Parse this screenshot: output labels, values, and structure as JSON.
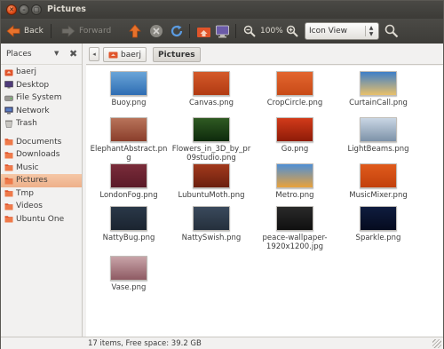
{
  "window": {
    "title": "Pictures"
  },
  "toolbar": {
    "back_label": "Back",
    "forward_label": "Forward",
    "zoom_level": "100%",
    "view_mode": "Icon View"
  },
  "sidebar": {
    "header": "Places",
    "items": [
      {
        "label": "baerj",
        "icon": "home-folder-icon",
        "group": 1
      },
      {
        "label": "Desktop",
        "icon": "desktop-icon",
        "group": 1
      },
      {
        "label": "File System",
        "icon": "drive-icon",
        "group": 1
      },
      {
        "label": "Network",
        "icon": "network-icon",
        "group": 1
      },
      {
        "label": "Trash",
        "icon": "trash-icon",
        "group": 1
      },
      {
        "label": "Documents",
        "icon": "folder-icon",
        "group": 2
      },
      {
        "label": "Downloads",
        "icon": "folder-icon",
        "group": 2
      },
      {
        "label": "Music",
        "icon": "folder-icon",
        "group": 2
      },
      {
        "label": "Pictures",
        "icon": "folder-icon",
        "group": 2,
        "active": true
      },
      {
        "label": "Tmp",
        "icon": "folder-icon",
        "group": 2
      },
      {
        "label": "Videos",
        "icon": "folder-icon",
        "group": 2
      },
      {
        "label": "Ubuntu One",
        "icon": "folder-icon",
        "group": 2
      }
    ]
  },
  "pathbar": {
    "crumbs": [
      "baerj",
      "Pictures"
    ]
  },
  "files": [
    {
      "name": "Buoy.png",
      "colors": [
        "#6aa5d8",
        "#2e6db3"
      ]
    },
    {
      "name": "Canvas.png",
      "colors": [
        "#d45a2a",
        "#b13a12"
      ]
    },
    {
      "name": "CropCircle.png",
      "colors": [
        "#e3662f",
        "#c84a17"
      ]
    },
    {
      "name": "CurtainCall.png",
      "colors": [
        "#3e7fc8",
        "#e8c06a"
      ]
    },
    {
      "name": "ElephantAbstract.png",
      "colors": [
        "#b8735a",
        "#8a3e2b"
      ]
    },
    {
      "name": "Flowers_in_3D_by_pr09studio.png",
      "colors": [
        "#2f5a22",
        "#0e2a0c"
      ]
    },
    {
      "name": "Go.png",
      "colors": [
        "#d23b1a",
        "#8e1b08"
      ]
    },
    {
      "name": "LightBeams.png",
      "colors": [
        "#c9d6e4",
        "#7d92a8"
      ]
    },
    {
      "name": "LondonFog.png",
      "colors": [
        "#7a2c3a",
        "#5a1a28"
      ]
    },
    {
      "name": "LubuntuMoth.png",
      "colors": [
        "#a23a1d",
        "#6b1f0e"
      ]
    },
    {
      "name": "Metro.png",
      "colors": [
        "#4e8fd6",
        "#e9a23b"
      ]
    },
    {
      "name": "MusicMixer.png",
      "colors": [
        "#e05b1c",
        "#c2400c"
      ]
    },
    {
      "name": "NattyBug.png",
      "colors": [
        "#2a3848",
        "#1b2430"
      ]
    },
    {
      "name": "NattySwish.png",
      "colors": [
        "#3a4a5c",
        "#25303c"
      ]
    },
    {
      "name": "peace-wallpaper-1920x1200.jpg",
      "colors": [
        "#2a2a2a",
        "#101010"
      ]
    },
    {
      "name": "Sparkle.png",
      "colors": [
        "#0f1c3f",
        "#050b1e"
      ]
    },
    {
      "name": "Vase.png",
      "colors": [
        "#c8a4a8",
        "#8e5a63"
      ]
    }
  ],
  "status": {
    "text": "17 items, Free space: 39.2 GB"
  }
}
